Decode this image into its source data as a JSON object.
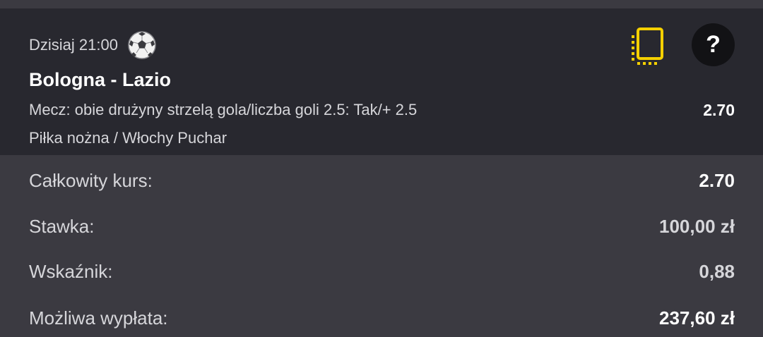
{
  "bet": {
    "time": "Dzisiaj 21:00",
    "sport_icon": "soccer-ball-icon",
    "match": "Bologna - Lazio",
    "market": "Mecz: obie drużyny strzelą gola/liczba goli 2.5: Tak/+ 2.5",
    "odds": "2.70",
    "category": "Piłka nożna / Włochy Puchar"
  },
  "actions": {
    "doc_icon": "document-icon",
    "help_label": "?"
  },
  "summary": {
    "total_odds_label": "Całkowity kurs:",
    "total_odds_value": "2.70",
    "stake_label": "Stawka:",
    "stake_value": "100,00 zł",
    "indicator_label": "Wskaźnik:",
    "indicator_value": "0,88",
    "payout_label": "Możliwa wypłata:",
    "payout_value": "237,60 zł"
  },
  "colors": {
    "background": "#3b3a41",
    "card": "#28282f",
    "accent_yellow": "#f5d000",
    "text_primary": "#ffffff",
    "text_secondary": "#d6d6da"
  }
}
